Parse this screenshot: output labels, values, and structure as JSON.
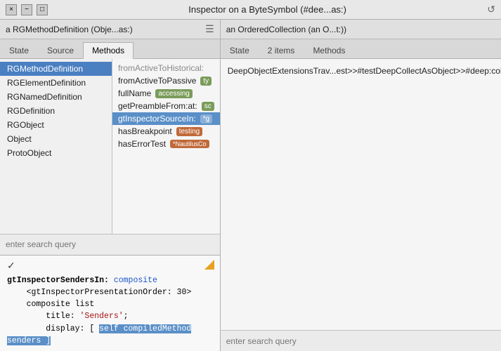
{
  "titleBar": {
    "title": "Inspector on a ByteSymbol (#dee...as:)",
    "closeBtn": "×",
    "minBtn": "−",
    "maxBtn": "□",
    "refreshBtn": "↺"
  },
  "leftPane": {
    "header": "a RGMethodDefinition (Obje...as:)",
    "tabs": [
      {
        "label": "State",
        "active": false
      },
      {
        "label": "Source",
        "active": false
      },
      {
        "label": "Methods",
        "active": true
      }
    ],
    "methodList": [
      {
        "label": "RGMethodDefinition",
        "selected": true
      },
      {
        "label": "RGElementDefinition",
        "selected": false
      },
      {
        "label": "RGNamedDefinition",
        "selected": false
      },
      {
        "label": "RGDefinition",
        "selected": false
      },
      {
        "label": "RGObject",
        "selected": false
      },
      {
        "label": "Object",
        "selected": false
      },
      {
        "label": "ProtoObject",
        "selected": false
      }
    ],
    "methodDetail": [
      {
        "name": "fromActiveToHistorical:",
        "tag": null,
        "truncated": true
      },
      {
        "name": "fromActiveToPassive",
        "tag": "ty",
        "tagClass": "tag-sc"
      },
      {
        "name": "fullName",
        "tag": "accessing",
        "tagClass": "tag-accessing"
      },
      {
        "name": "getPreambleFrom:at:",
        "tag": "sc",
        "tagClass": "tag-sc"
      },
      {
        "name": "gtInspectorSourceIn:",
        "tag": "*g",
        "tagClass": "tag-gt",
        "highlighted": true
      },
      {
        "name": "hasBreakpoint",
        "tag": "testing",
        "tagClass": "tag-testing"
      },
      {
        "name": "hasErrorTest",
        "tag": "*NautilusCo",
        "tagClass": "tag-nautilus"
      }
    ],
    "searchPlaceholder": "enter search query",
    "code": {
      "checkmark": "✓",
      "lines": [
        {
          "text": "gtInspectorSendersIn: composite",
          "parts": [
            {
              "text": "gtInspectorSendersIn: ",
              "style": ""
            },
            {
              "text": "composite",
              "style": "blue"
            }
          ]
        },
        {
          "text": "    <gtInspectorPresentationOrder: 30>"
        },
        {
          "text": "    composite list"
        },
        {
          "text": "        title: 'Senders';"
        },
        {
          "text": "        display: [ self compiledMethod",
          "highlight": true
        },
        {
          "text": "senders ]"
        }
      ]
    }
  },
  "rightPane": {
    "header": "an OrderedCollection (an O...t:))",
    "tabs": [
      {
        "label": "State",
        "active": false
      },
      {
        "label": "2 items",
        "active": false
      },
      {
        "label": "Methods",
        "active": false
      }
    ],
    "content": "DeepObjectExtensionsTrav...est>>#testDeepCollectAsObject>>#deep:collect:",
    "searchPlaceholder": "enter search query"
  }
}
